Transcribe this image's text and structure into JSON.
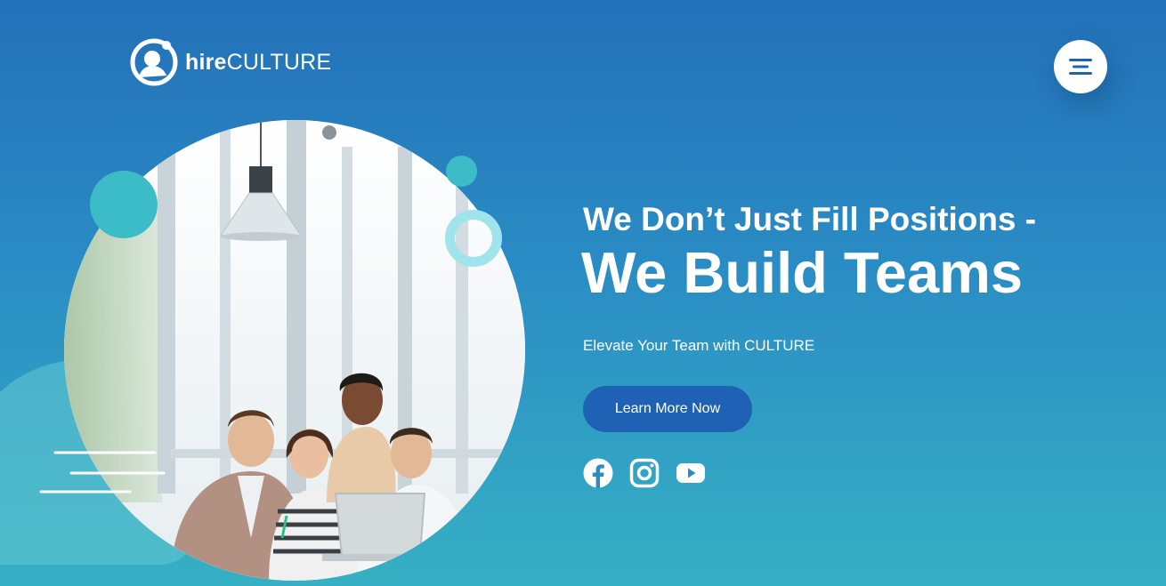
{
  "brand": {
    "bold": "hire",
    "light": "CULTURE"
  },
  "menu": {
    "icon": "hamburger-menu-icon"
  },
  "hero": {
    "headline_line1": "We Don’t Just Fill Positions -",
    "headline_line2": "We Build Teams",
    "subtext": "Elevate Your Team with CULTURE",
    "cta_label": "Learn More Now"
  },
  "socials": [
    {
      "icon": "facebook-icon"
    },
    {
      "icon": "instagram-icon"
    },
    {
      "icon": "youtube-icon"
    }
  ],
  "colors": {
    "gradient_top": "#2370b8",
    "gradient_bottom": "#36b0c4",
    "accent_teal": "#3cbcc6",
    "ring": "#9fe3ec",
    "button": "#1f62b5",
    "text": "#ffffff"
  }
}
